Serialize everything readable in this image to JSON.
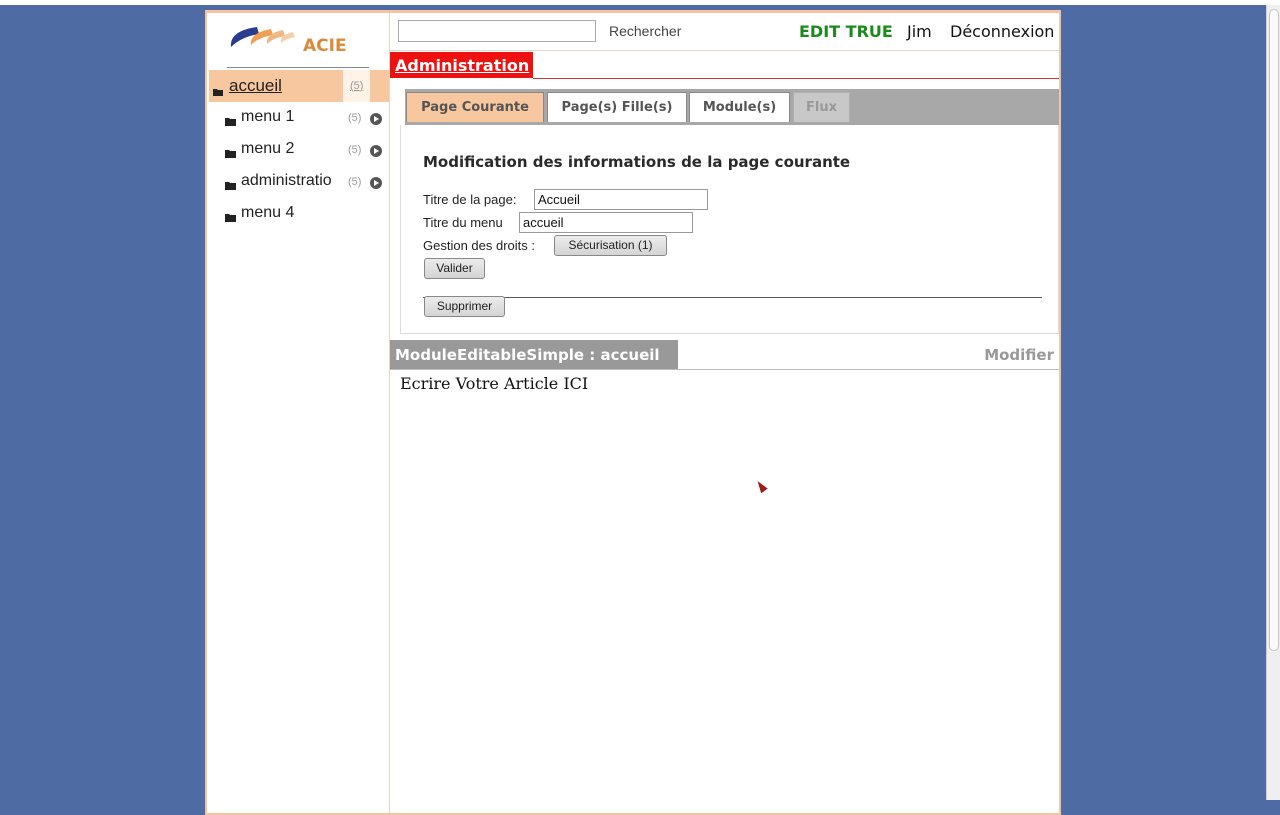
{
  "header": {
    "search_placeholder": "",
    "search_label": "Rechercher",
    "edit_status": "EDIT TRUE",
    "user": "Jim",
    "logout": "Déconnexion"
  },
  "logo": {
    "text": "ACIE"
  },
  "sidebar": {
    "items": [
      {
        "label": "accueil",
        "count": "(5)"
      },
      {
        "label": "menu 1",
        "count": "(5)"
      },
      {
        "label": "menu 2",
        "count": "(5)"
      },
      {
        "label": "administratio",
        "count": "(5)"
      },
      {
        "label": "menu 4",
        "count": ""
      }
    ]
  },
  "admin": {
    "title": "Administration"
  },
  "tabs": [
    {
      "label": "Page Courante"
    },
    {
      "label": "Page(s) Fille(s)"
    },
    {
      "label": "Module(s)"
    },
    {
      "label": "Flux"
    }
  ],
  "form": {
    "title": "Modification des informations de la page courante",
    "page_title_label": "Titre de la page:",
    "page_title_value": "Accueil",
    "menu_title_label": "Titre du menu",
    "menu_title_value": "accueil",
    "rights_label": "Gestion des droits :",
    "security_button": "Sécurisation (1)",
    "validate_button": "Valider",
    "delete_button": "Supprimer"
  },
  "module": {
    "title": "ModuleEditableSimple : accueil",
    "modify": "Modifier",
    "content": "Ecrire Votre Article ICI"
  },
  "colors": {
    "background": "#4e6ba3",
    "accent": "#f7c79f",
    "admin_red": "#ee1111",
    "edit_green": "#1a8a1a"
  }
}
